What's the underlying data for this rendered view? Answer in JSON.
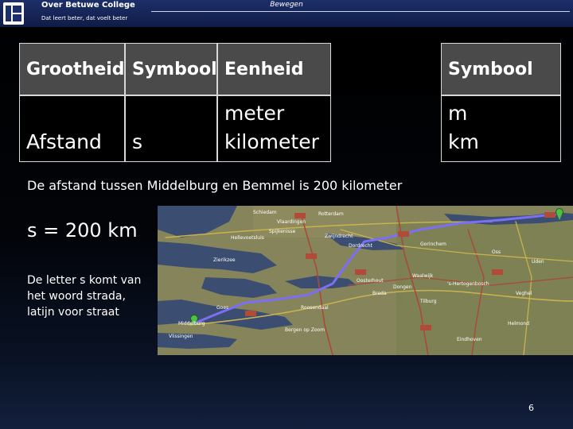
{
  "header": {
    "college_name": "Over Betuwe College",
    "slogan": "Dat leert beter, dat voelt beter",
    "title": "Bewegen"
  },
  "table": {
    "headers": [
      "Grootheid",
      "Symbool",
      "Eenheid",
      "Symbool"
    ],
    "row": {
      "quantity": "Afstand",
      "symbol": "s",
      "units": [
        "meter",
        "kilometer"
      ],
      "unit_symbols": [
        "m",
        "km"
      ]
    }
  },
  "statement": "De afstand tussen Middelburg en Bemmel is 200 kilometer",
  "formula": "s = 200 km",
  "note": "De letter s komt van het woord strada, latijn voor straat",
  "map": {
    "labels": [
      "Rotterdam",
      "Vlaardingen",
      "Dordrecht",
      "Zwijndrecht",
      "Gorinchem",
      "Schiedam",
      "Breda",
      "Tilburg",
      "Roosendaal",
      "Bergen op Zoom",
      "Middelburg",
      "Vlissingen",
      "Goes",
      "Oss",
      "Uden",
      "Waalwijk",
      "'s-Hertogenbosch",
      "Eindhoven",
      "Helmond",
      "Veghel",
      "Zierikzee",
      "Dongen",
      "Oosterhout",
      "Hellevoetsluis",
      "Spijkenisse"
    ],
    "colors": {
      "land": "#8a8a5a",
      "water": "#3c4e72",
      "route": "#7c6ef5",
      "roads_red": "#b24a3a",
      "roads_yellow": "#d8c45a"
    }
  },
  "page_number": "6"
}
